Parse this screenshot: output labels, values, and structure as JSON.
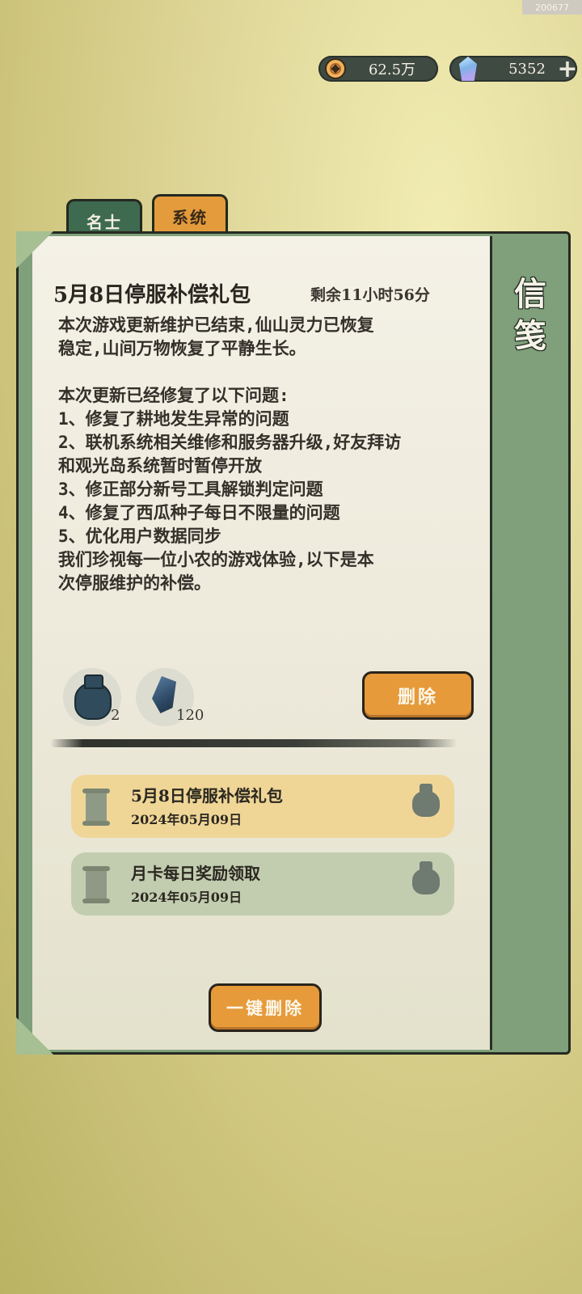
{
  "build_id": "200677",
  "currency": {
    "coins": {
      "icon": "coin-icon",
      "value": "62.5万"
    },
    "gems": {
      "icon": "gem-icon",
      "value": "5352",
      "add_icon": "plus-icon"
    }
  },
  "tabs": [
    {
      "label": "名士",
      "active": true
    },
    {
      "label": "系统",
      "active": false
    }
  ],
  "panel": {
    "side_title": "信\n笺"
  },
  "mail": {
    "title": "5月8日停服补偿礼包",
    "remaining": "剩余11小时56分",
    "body": "本次游戏更新维护已结束,仙山灵力已恢复\n稳定,山间万物恢复了平静生长。\n\n本次更新已经修复了以下问题:\n1、修复了耕地发生异常的问题\n2、联机系统相关维修和服务器升级,好友拜访\n和观光岛系统暂时暂停开放\n3、修正部分新号工具解锁判定问题\n4、修复了西瓜种子每日不限量的问题\n5、优化用户数据同步\n我们珍视每一位小农的游戏体验,以下是本\n次停服维护的补偿。",
    "attachments": [
      {
        "icon": "pouch-icon",
        "count": "2"
      },
      {
        "icon": "stone-icon",
        "count": "120"
      }
    ],
    "delete_label": "删除"
  },
  "mail_list": [
    {
      "title": "5月8日停服补偿礼包",
      "date": "2024年05月09日",
      "selected": true
    },
    {
      "title": "月卡每日奖励领取",
      "date": "2024年05月09日",
      "selected": false
    }
  ],
  "delete_all_label": "一键删除"
}
